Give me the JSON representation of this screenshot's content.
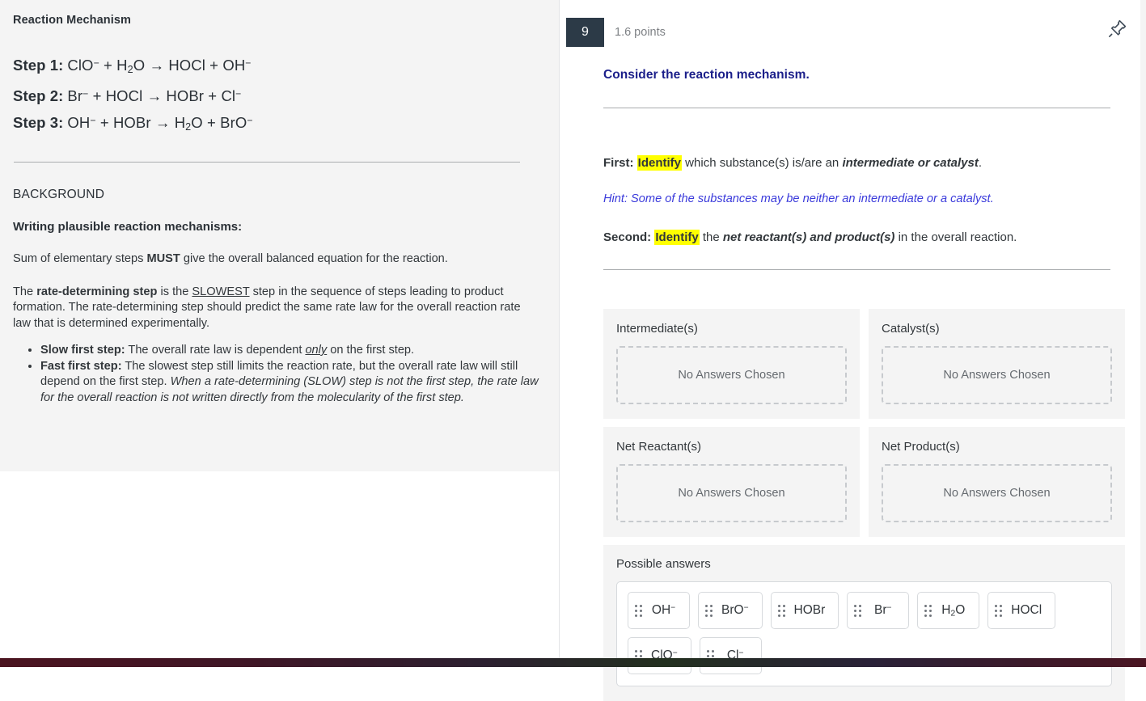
{
  "left_panel": {
    "title": "Reaction Mechanism",
    "steps": [
      {
        "label": "Step 1:",
        "equation_html": "ClO<sup>−</sup> + H<sub>2</sub>O → HOCl + OH<sup>−</sup>"
      },
      {
        "label": "Step 2:",
        "equation_html": "Br<sup>−</sup> + HOCl → HOBr + Cl<sup>−</sup>"
      },
      {
        "label": "Step 3:",
        "equation_html": "OH<sup>−</sup> + HOBr → H<sub>2</sub>O + BrO<sup>−</sup>"
      }
    ],
    "background_heading": "BACKGROUND",
    "background_subheading": "Writing plausible reaction mechanisms:",
    "paragraph_1_html": "Sum of elementary steps <b>MUST</b> give the overall balanced equation for the reaction.",
    "paragraph_2_html": "The <b>rate-determining step</b> is the <u>SLOWEST</u> step in the sequence of steps leading to product formation. The rate-determining step should predict the same rate law for the overall reaction rate law that is determined experimentally.",
    "bullets_html": [
      "<b>Slow first step:</b> The overall rate law is dependent <u><i>only</i></u> on the first step.",
      "<b>Fast first step:</b> The slowest step still limits the reaction rate, but the overall rate law will still depend on the first step. <i>When a rate-determining (SLOW) step is not the first step, the rate law for the overall reaction is not written directly from the molecularity of the first step.</i>"
    ]
  },
  "question": {
    "number": "9",
    "points": "1.6 points",
    "title": "Consider the reaction mechanism.",
    "instruction_first_html": "<b>First:</b> <span class=\"hl\">Identify</span> which substance(s) is/are an <span class=\"bi\">intermediate or catalyst</span>.",
    "hint": "Hint: Some of the substances may be neither an intermediate or a catalyst.",
    "instruction_second_html": "<b>Second:</b> <span class=\"hl\">Identify</span> the <span class=\"bi\">net reactant(s) and product(s)</span> in the overall reaction.",
    "pin_icon": "pushpin-icon"
  },
  "zones": [
    {
      "label": "Intermediate(s)",
      "placeholder": "No Answers Chosen"
    },
    {
      "label": "Catalyst(s)",
      "placeholder": "No Answers Chosen"
    },
    {
      "label": "Net Reactant(s)",
      "placeholder": "No Answers Chosen"
    },
    {
      "label": "Net Product(s)",
      "placeholder": "No Answers Chosen"
    }
  ],
  "possible_answers": {
    "label": "Possible answers",
    "tiles": [
      {
        "html": "OH<sup>−</sup>",
        "name": "answer-tile-oh-minus"
      },
      {
        "html": "BrO<sup>−</sup>",
        "name": "answer-tile-bro-minus"
      },
      {
        "html": "HOBr",
        "name": "answer-tile-hobr"
      },
      {
        "html": "Br<sup>−</sup>",
        "name": "answer-tile-br-minus"
      },
      {
        "html": "H<sub>2</sub>O",
        "name": "answer-tile-h2o"
      },
      {
        "html": "HOCl",
        "name": "answer-tile-hocl"
      },
      {
        "html": "ClO<sup>−</sup>",
        "name": "answer-tile-clo-minus"
      },
      {
        "html": "Cl<sup>−</sup>",
        "name": "answer-tile-cl-minus"
      }
    ]
  },
  "colors": {
    "badge_bg": "#2c3a47",
    "question_title": "#1b1f8a",
    "hint": "#3a3adb",
    "highlight": "#ffff00",
    "panel_bg": "#f4f4f4"
  }
}
